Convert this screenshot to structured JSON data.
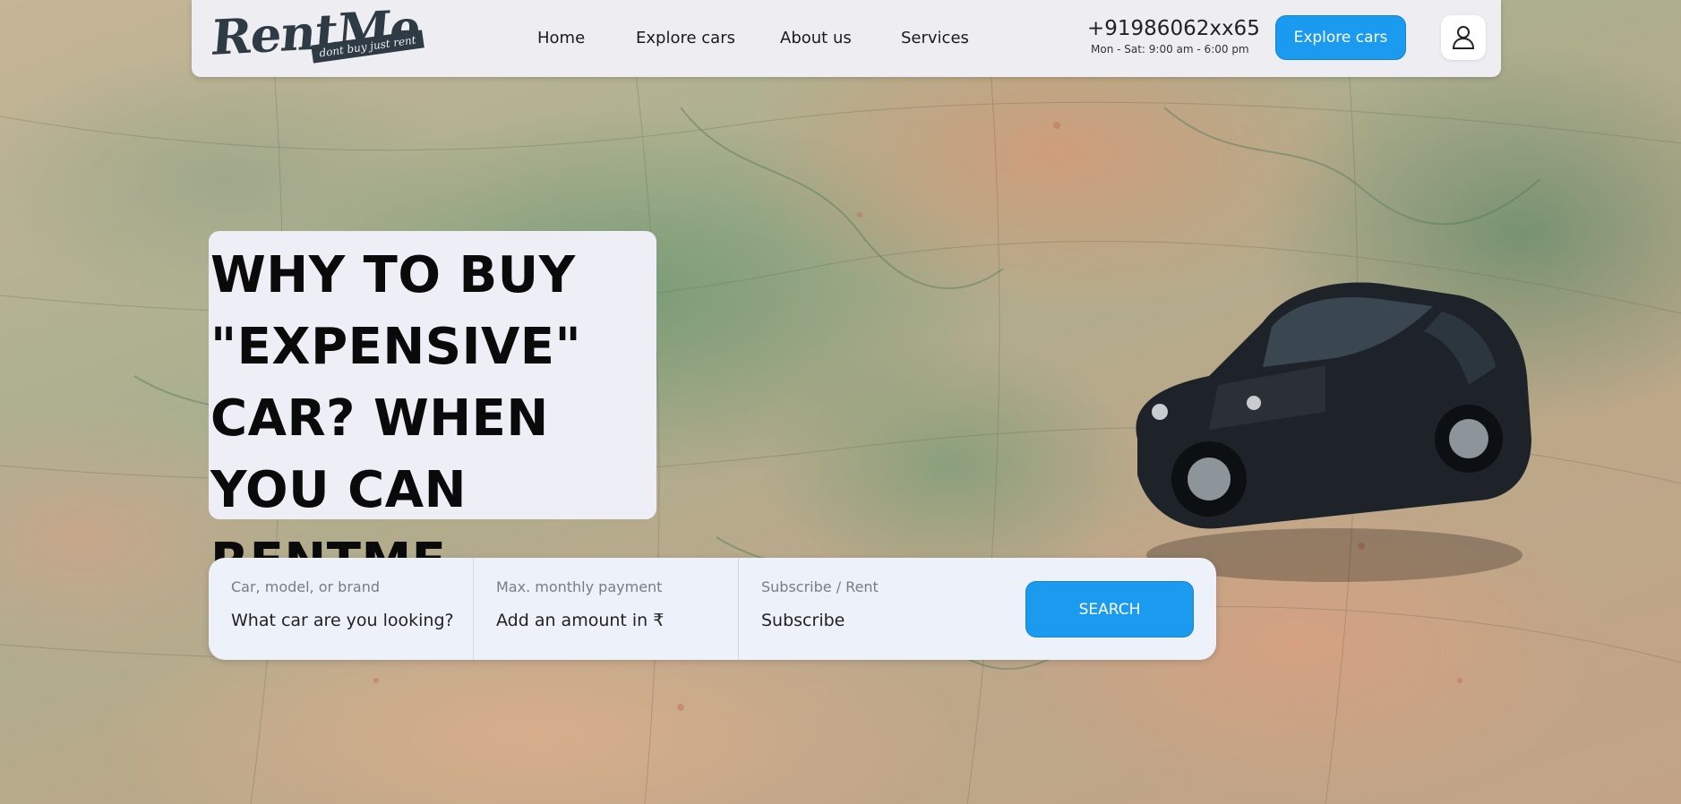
{
  "brand": {
    "logo_text": "RentMe",
    "tagline": "dont buy just rent"
  },
  "nav": {
    "links": [
      "Home",
      "Explore cars",
      "About us",
      "Services"
    ],
    "phone": "+91986062xx65",
    "hours": "Mon - Sat: 9:00 am - 6:00 pm",
    "cta_label": "Explore cars",
    "user_icon": "user-icon"
  },
  "hero": {
    "headline": "WHY TO BUY \"EXPENSIVE\" CAR? WHEN YOU CAN RENTME...",
    "background": "map with toy car"
  },
  "search": {
    "fields": [
      {
        "label": "Car, model, or brand",
        "placeholder": "What car are you looking?"
      },
      {
        "label": "Max. monthly payment",
        "placeholder": "Add an amount in ₹"
      },
      {
        "label": "Subscribe / Rent",
        "value": "Subscribe"
      }
    ],
    "button_label": "SEARCH"
  },
  "colors": {
    "accent": "#1a9bf0",
    "nav_bg": "#ededf2",
    "logo": "#2e3b44",
    "headline_bg": "#edeef6"
  }
}
